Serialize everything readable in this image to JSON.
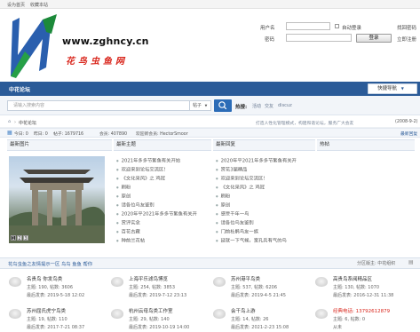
{
  "topbar": {
    "set_home": "设为首页",
    "bookmark": "收藏本站"
  },
  "logo": {
    "domain": "www.zghncy.cn",
    "brand_cn": "花鸟虫鱼网"
  },
  "login": {
    "username_label": "用户名",
    "password_label": "密码",
    "auto_login": "自动登录",
    "find_password": "找回密码",
    "login_button": "登录",
    "register": "立即注册",
    "register_prefix": "立即注册"
  },
  "nav": {
    "title": "中花论坛",
    "quick": "快捷导航"
  },
  "search": {
    "placeholder": "请输入搜索内容",
    "select_value": "帖子",
    "hot_label": "热搜:",
    "hot_links": [
      "活动",
      "交友",
      "discuz"
    ]
  },
  "crumb": {
    "home": "中花论坛",
    "notice": "打造人性化管理模式，构建和谐论坛，服务广大会友",
    "date": "(2008-9-2)"
  },
  "stats": {
    "today": "今日: 0",
    "yesterday": "昨日: 0",
    "posts": "帖子: 1679716",
    "members": "会员: 407890",
    "newest": "欢迎新会员: HectorSmoor",
    "right": "最新回复"
  },
  "columns": {
    "photo": "最新图片",
    "topics": "最新主题",
    "replies": "最新回复",
    "hot": "热帖"
  },
  "photo_numbers": [
    "1",
    "2",
    "3"
  ],
  "latest_topics": [
    "2021年多多节繁鱼有关开始",
    "欢迎来到论坛交流区！",
    "《文化采风》之 鸡冠",
    "刷粉",
    "原创",
    "请各位鸟友鉴别",
    "2020年平2021年多多节繁鱼有关开",
    "赏评实念",
    "百花古藏",
    "种前兰花帖"
  ],
  "latest_replies": [
    "2020年平2021年多多节繁鱼有关开",
    "赏花3届精品",
    "欢迎来到论坛交流区！",
    "《文化采风》之 鸡冠",
    "刷粉",
    "原创",
    "感受千年一鸟",
    "请各位鸟友鉴别",
    "门前杜鹃鸟友一族",
    "延就一下气候，宽孔兵有气的鸟"
  ],
  "forum_section": {
    "title": "花鸟虫鱼之友情提示一区 鸟鸟 鱼鱼 帮你",
    "right": "分区版主: 中花组织"
  },
  "forums": [
    {
      "name": "名贵鸟 你发鸟类",
      "stat": "主题: 190, 帖数: 3606",
      "last": "最后发表: 2019-5-18 12:02"
    },
    {
      "name": "上海平乐滤鸟博览",
      "stat": "主题: 254, 帖数: 3853",
      "last": "最后发表: 2019-7-12 23:13"
    },
    {
      "name": "苏州港平鸟类",
      "stat": "主题: 537, 帖数: 6206",
      "last": "最后发表: 2019-4-5 21:45"
    },
    {
      "name": "高贵鸟系阅精品区",
      "stat": "主题: 130, 帖数: 1070",
      "last": "最后发表: 2016-12-31 11:38"
    },
    {
      "name": "苏州屈氏虎宁鸟类",
      "stat": "主题: 19, 帖数: 110",
      "last": "最后发表: 2017-7-21 08:37"
    },
    {
      "name": "杭州云母鸟类工作室",
      "stat": "主题: 29, 帖数: 140",
      "last": "最后发表: 2019-10-19 14:00"
    },
    {
      "name": "会干鸟上游",
      "stat": "主题: 14, 帖数: 26",
      "last": "最后发表: 2021-2-23 15:08"
    },
    {
      "name": "经典电话: 13792612879",
      "stat": "主题: 6, 帖数: 0",
      "last": "从未"
    }
  ],
  "colors": {
    "nav_blue": "#2b5b98",
    "brand_red": "#d9261c",
    "phone_red": "#d9261c"
  }
}
